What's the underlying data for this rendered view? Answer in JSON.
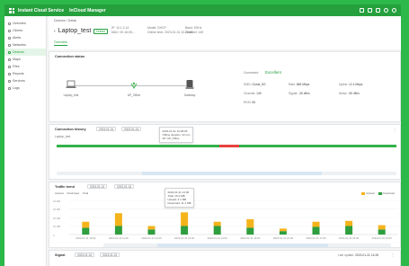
{
  "app": {
    "title": "Instant Cloud Service",
    "module": "InCloud Manager",
    "top_icons": [
      "grid-icon",
      "message-icon",
      "doc-icon",
      "bell-icon",
      "help-icon",
      "user-icon"
    ]
  },
  "sidebar": {
    "items": [
      {
        "label": "Overview",
        "icon": "overview-icon"
      },
      {
        "label": "Clients",
        "icon": "clients-icon"
      },
      {
        "label": "Alerts",
        "icon": "alert-icon"
      },
      {
        "label": "Networks",
        "icon": "network-icon"
      },
      {
        "label": "Devices",
        "icon": "devices-icon"
      },
      {
        "label": "Maps",
        "icon": "map-icon"
      },
      {
        "label": "Files",
        "icon": "files-icon"
      },
      {
        "label": "Reports",
        "icon": "reports-icon"
      },
      {
        "label": "Services",
        "icon": "services-icon"
      },
      {
        "label": "Logs",
        "icon": "logs-icon"
      }
    ],
    "active_index": 4
  },
  "header": {
    "breadcrumb": "Devices / Detail",
    "device_name": "Laptop_test",
    "status": "Online",
    "meta_col1": [
      "IP: 10.1.2.14",
      "MAC: 00:18:05:...",
      "Vendor: Intel"
    ],
    "meta_col2": [
      "Model: DHCP",
      "Online time: 2023-01-31",
      "10:28:05"
    ],
    "meta_col3": [
      "Band: 5GHz",
      "Channel: 149",
      "Signal: -45 dBm"
    ],
    "tab": "Overview"
  },
  "connection": {
    "title": "Connection status",
    "nodes": [
      {
        "label": "Laptop_test",
        "icon": "laptop-icon"
      },
      {
        "label": "AP_Office",
        "icon": "ap-icon"
      },
      {
        "label": "Gateway",
        "icon": "router-icon"
      }
    ],
    "status_label": "Connected:",
    "status_value": "Excellent",
    "details": [
      {
        "k": "SSID:",
        "v": "Guest_5G"
      },
      {
        "k": "Rate:",
        "v": "866 Mbps"
      },
      {
        "k": "Uplink:",
        "v": "12.4 Mbps"
      },
      {
        "k": "Channel:",
        "v": "149"
      },
      {
        "k": "Signal:",
        "v": "-45 dBm"
      },
      {
        "k": "Noise:",
        "v": "-95 dBm"
      },
      {
        "k": "RSSI:",
        "v": "50"
      }
    ]
  },
  "history": {
    "title": "Connection history",
    "range_from": "2023-01-31",
    "range_to": "2023-01-31",
    "row_label": "Laptop_test",
    "tooltip": [
      "2023-01-31 10:28:05",
      "Offline duration: 12 min",
      "AP: AP_Office"
    ],
    "colors": {
      "online": "#33b24a",
      "offline": "#e8413e"
    }
  },
  "traffic": {
    "title": "Traffic trend",
    "range_from": "2023-01-31",
    "range_to": "2023-01-31",
    "filters": [
      "Upload",
      "Download",
      "Total"
    ],
    "legend": [
      {
        "name": "Upload",
        "color": "#f5b31b"
      },
      {
        "name": "Download",
        "color": "#2e9e3e"
      }
    ],
    "tooltip": [
      "2023-01-31 14:00",
      "Total: 15.2 MB",
      "Upload: 4.1 MB",
      "Download: 11.1 MB"
    ],
    "yticks": [
      "40 MB",
      "30 MB",
      "20 MB",
      "10 MB",
      "0"
    ]
  },
  "chart_data": {
    "type": "bar",
    "stacked": true,
    "categories": [
      "2023-01-31 10:00",
      "2023-01-31 11:00",
      "2023-01-31 12:00",
      "2023-01-31 13:00",
      "2023-01-31 14:00",
      "2023-01-31 15:00",
      "2023-01-31 16:00",
      "2023-01-31 17:00",
      "2023-01-31 18:00",
      "2023-01-31 19:00"
    ],
    "series": [
      {
        "name": "Download",
        "values": [
          8,
          10,
          6,
          10,
          10,
          8,
          4,
          9,
          10,
          6
        ]
      },
      {
        "name": "Upload",
        "values": [
          7,
          15,
          4,
          16,
          5,
          10,
          3,
          6,
          6,
          5
        ]
      }
    ],
    "ylim": [
      0,
      40
    ]
  },
  "footer_card": {
    "title": "Signal",
    "range_from": "2023-01-31",
    "range_to": "2023-01-31",
    "right_label": "Last update:",
    "right_value": "2023-01-31 14:28"
  }
}
